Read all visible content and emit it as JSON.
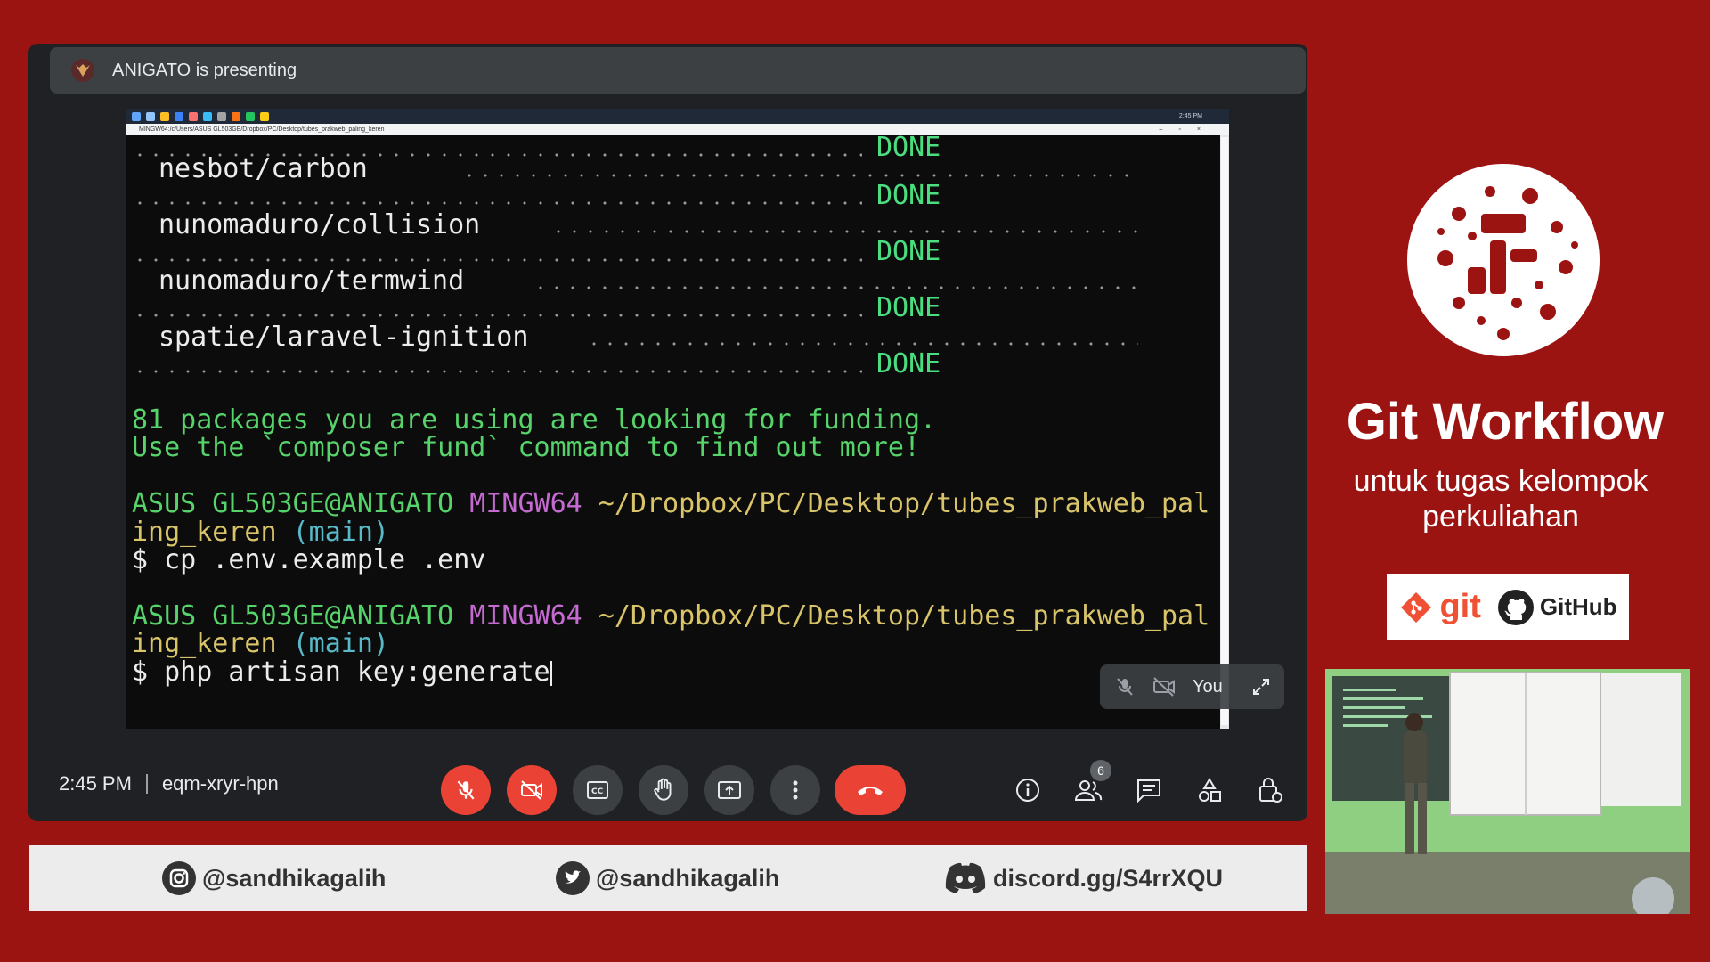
{
  "meet": {
    "presenting_text": "ANIGATO is presenting",
    "time": "2:45 PM",
    "meeting_code": "eqm-xryr-hpn",
    "self_label": "You",
    "participants_count": "6"
  },
  "screen": {
    "terminal_title": "MINGW64:/c/Users/ASUS GL503GE/Dropbox/PC/Desktop/tubes_prakweb_paling_keren",
    "taskbar_clock": "2:45 PM",
    "done_label": "DONE",
    "packages": [
      "nesbot/carbon",
      "nunomaduro/collision",
      "nunomaduro/termwind",
      "spatie/laravel-ignition"
    ],
    "funding_line1": "81 packages you are using are looking for funding.",
    "funding_line2": "Use the `composer fund` command to find out more!",
    "prompt_user": "ASUS GL503GE@ANIGATO",
    "prompt_shell": "MINGW64",
    "prompt_path_1": "~/Dropbox/PC/Desktop/tubes_prakweb_pal",
    "prompt_path_2": "ing_keren",
    "prompt_branch": "(main)",
    "cmd1": "$ cp .env.example .env",
    "cmd2": "$ php artisan key:generate"
  },
  "social": {
    "instagram": "@sandhikagalih",
    "twitter": "@sandhikagalih",
    "discord": "discord.gg/S4rrXQU"
  },
  "brand": {
    "title": "Git Workflow",
    "subtitle": "untuk tugas kelompok perkuliahan",
    "git_label": "git",
    "github_label": "GitHub"
  },
  "colors": {
    "background": "#9c1412",
    "end_call": "#ea4335",
    "done_green": "#4ade80"
  }
}
